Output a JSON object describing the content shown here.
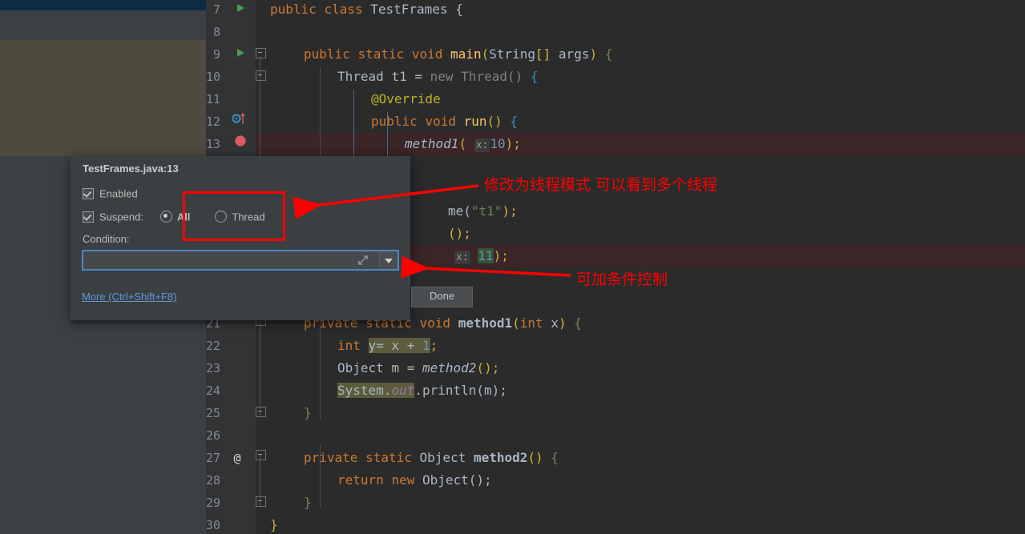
{
  "editor": {
    "file": "TestFrames.java",
    "lines": [
      {
        "n": 7,
        "indent": 0,
        "gutter": "run-arrow"
      },
      {
        "n": 8,
        "indent": 0,
        "gutter": ""
      },
      {
        "n": 9,
        "indent": 0,
        "gutter": "run-arrow"
      },
      {
        "n": 10,
        "indent": 0,
        "gutter": ""
      },
      {
        "n": 11,
        "indent": 0,
        "gutter": ""
      },
      {
        "n": 12,
        "indent": 0,
        "gutter": "override-marker"
      },
      {
        "n": 13,
        "indent": 0,
        "gutter": "breakpoint"
      },
      {
        "n": 21,
        "indent": 0,
        "gutter": ""
      },
      {
        "n": 22,
        "indent": 0,
        "gutter": ""
      },
      {
        "n": 23,
        "indent": 0,
        "gutter": ""
      },
      {
        "n": 24,
        "indent": 0,
        "gutter": ""
      },
      {
        "n": 25,
        "indent": 0,
        "gutter": ""
      },
      {
        "n": 26,
        "indent": 0,
        "gutter": ""
      },
      {
        "n": 27,
        "indent": 0,
        "gutter": "annotation-at"
      },
      {
        "n": 28,
        "indent": 0,
        "gutter": ""
      },
      {
        "n": 29,
        "indent": 0,
        "gutter": ""
      },
      {
        "n": 30,
        "indent": 0,
        "gutter": ""
      }
    ],
    "line_numbers": {
      "l7": "7",
      "l8": "8",
      "l9": "9",
      "l10": "10",
      "l11": "11",
      "l12": "12",
      "l13": "13",
      "l21": "21",
      "l22": "22",
      "l23": "23",
      "l24": "24",
      "l25": "25",
      "l26": "26",
      "l27": "27",
      "l28": "28",
      "l29": "29",
      "l30": "30"
    },
    "code": {
      "l7_public": "public",
      "l7_class": "class",
      "l7_name": "TestFrames",
      "l7_brace": "{",
      "l9_public": "public",
      "l9_static": "static",
      "l9_void": "void",
      "l9_main": "main",
      "l9_paren1": "(",
      "l9_string": "String",
      "l9_brackets": "[]",
      "l9_args": "args",
      "l9_paren2": ")",
      "l9_brace": "{",
      "l10_thread": "Thread",
      "l10_t1": "t1",
      "l10_eq": "=",
      "l10_new": "new",
      "l10_ctor": "Thread()",
      "l10_brace": "{",
      "l11_override": "@Override",
      "l12_public": "public",
      "l12_void": "void",
      "l12_run": "run",
      "l12_parens": "()",
      "l12_brace": "{",
      "l13_method1": "method1",
      "l13_paren1": "(",
      "l13_hint": "x:",
      "l13_num": "10",
      "l13_tail": ");",
      "lh1_tail": "me(",
      "lh1_str": "\"t1\"",
      "lh1_end": ");",
      "lh2_tail": "();",
      "lh3_hint": "x:",
      "lh3_num": "11",
      "lh3_tail": ");",
      "l21_private": "private",
      "l21_static": "static",
      "l21_void": "void",
      "l21_method1": "method1",
      "l21_paren1": "(",
      "l21_int": "int",
      "l21_x": "x",
      "l21_paren2": ")",
      "l21_brace": "{",
      "l22_int": "int",
      "l22_y": "y",
      "l22_expr": "= x + ",
      "l22_num": "1",
      "l22_semi": ";",
      "l23_object": "Object",
      "l23_m": "m",
      "l23_eq": "=",
      "l23_method2": "method2",
      "l23_tail": "();",
      "l24_system": "System.",
      "l24_out": "out",
      "l24_println": ".println(m);",
      "l25_brace": "}",
      "l27_private": "private",
      "l27_static": "static",
      "l27_object": "Object",
      "l27_method2": "method2",
      "l27_parens": "()",
      "l27_brace": "{",
      "l28_return": "return",
      "l28_new": "new",
      "l28_object": "Object();",
      "l29_brace": "}",
      "l30_brace": "}",
      "l27_at": "@"
    }
  },
  "breakpoint_dialog": {
    "title": "TestFrames.java:13",
    "enabled_label": "Enabled",
    "enabled_checked": true,
    "suspend_label": "Suspend:",
    "suspend_checked": true,
    "radio_all_label": "All",
    "radio_all_selected": true,
    "radio_thread_label": "Thread",
    "radio_thread_selected": false,
    "condition_label": "Condition:",
    "condition_value": "",
    "condition_placeholder": "",
    "more_link": "More (Ctrl+Shift+F8)",
    "done_label": "Done"
  },
  "annotations": {
    "note_thread_mode": "修改为线程模式 可以看到多个线程",
    "note_condition": "可加条件控制",
    "highlight_color": "#ff0000"
  },
  "colors": {
    "editor_bg": "#2b2b2b",
    "gutter_bg": "#313335",
    "dialog_bg": "#3c3f41",
    "breakpoint_row": "#3a2527",
    "accent_blue": "#4a88c7",
    "link_blue": "#5e9ad4",
    "keyword_orange": "#cc7832",
    "string_green": "#6a8759",
    "number_blue": "#6897bb",
    "method_yellow": "#ffc66d",
    "annotation_yellow": "#bbb529",
    "search_highlight": "#5c5c3d",
    "left_navy": "#0e2c45",
    "left_olive": "#4e4a3e"
  }
}
